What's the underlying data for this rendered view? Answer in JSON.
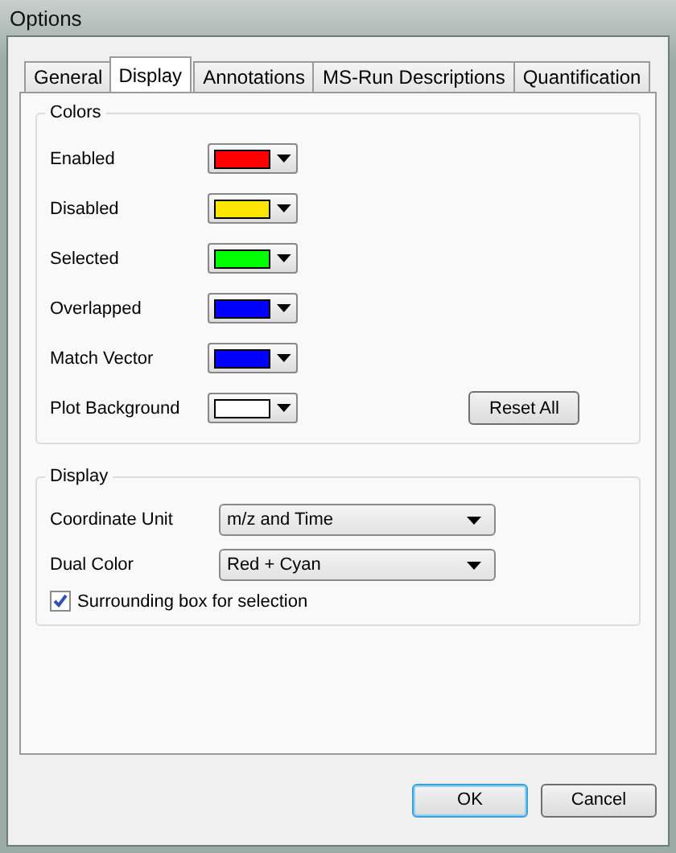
{
  "window": {
    "title": "Options"
  },
  "tabs": [
    {
      "label": "General",
      "selected": false
    },
    {
      "label": "Display",
      "selected": true
    },
    {
      "label": "Annotations",
      "selected": false
    },
    {
      "label": "MS-Run Descriptions",
      "selected": false
    },
    {
      "label": "Quantification",
      "selected": false
    }
  ],
  "colors_group": {
    "title": "Colors",
    "reset_button": "Reset All",
    "items": [
      {
        "label": "Enabled",
        "color": "#ff0000"
      },
      {
        "label": "Disabled",
        "color": "#ffe600"
      },
      {
        "label": "Selected",
        "color": "#00ff00"
      },
      {
        "label": "Overlapped",
        "color": "#0000ff"
      },
      {
        "label": "Match Vector",
        "color": "#0000ff"
      },
      {
        "label": "Plot Background",
        "color": "#ffffff"
      }
    ]
  },
  "display_group": {
    "title": "Display",
    "selects": [
      {
        "label": "Coordinate Unit",
        "value": "m/z and Time"
      },
      {
        "label": "Dual Color",
        "value": "Red + Cyan"
      }
    ],
    "checkbox": {
      "label": "Surrounding box for selection",
      "checked": true
    }
  },
  "buttons": [
    {
      "label": "OK",
      "kind": "default"
    },
    {
      "label": "Cancel",
      "kind": "normal"
    }
  ]
}
